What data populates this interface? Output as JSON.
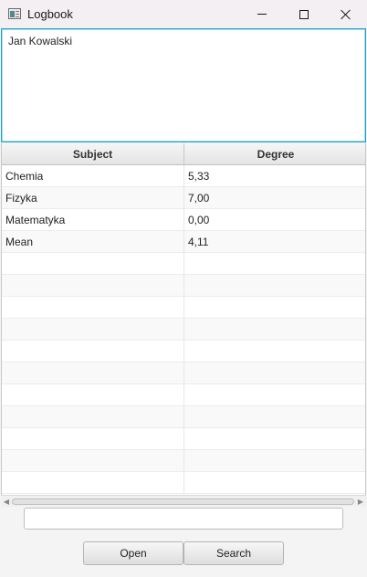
{
  "window": {
    "title": "Logbook"
  },
  "notes": {
    "text": "Jan Kowalski"
  },
  "table": {
    "columns": [
      "Subject",
      "Degree"
    ],
    "rows": [
      [
        "Chemia",
        "5,33"
      ],
      [
        "Fizyka",
        "7,00"
      ],
      [
        "Matematyka",
        "0,00"
      ],
      [
        "Mean",
        "4,11"
      ],
      [
        "",
        ""
      ],
      [
        "",
        ""
      ],
      [
        "",
        ""
      ],
      [
        "",
        ""
      ],
      [
        "",
        ""
      ],
      [
        "",
        ""
      ],
      [
        "",
        ""
      ],
      [
        "",
        ""
      ],
      [
        "",
        ""
      ],
      [
        "",
        ""
      ],
      [
        "",
        ""
      ]
    ]
  },
  "search": {
    "value": "",
    "placeholder": ""
  },
  "buttons": {
    "open": "Open",
    "search": "Search"
  },
  "icons": {
    "app": "app-icon",
    "minimize": "minimize-icon",
    "maximize": "maximize-icon",
    "close": "close-icon"
  },
  "colors": {
    "focus_accent": "#1ba3c7"
  }
}
